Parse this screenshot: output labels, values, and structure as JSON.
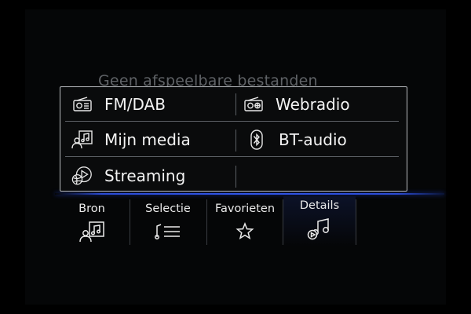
{
  "background_message": "Geen afspeelbare bestanden",
  "accent_color": "#2f55e8",
  "popup": {
    "items": [
      {
        "label": "FM/DAB",
        "icon": "radio-icon"
      },
      {
        "label": "Webradio",
        "icon": "webradio-icon"
      },
      {
        "label": "Mijn media",
        "icon": "media-user-icon"
      },
      {
        "label": "BT-audio",
        "icon": "bluetooth-icon"
      },
      {
        "label": "Streaming",
        "icon": "streaming-icon"
      }
    ]
  },
  "tabs": [
    {
      "label": "Bron",
      "icon": "media-source-icon"
    },
    {
      "label": "Selectie",
      "icon": "playlist-icon"
    },
    {
      "label": "Favorieten",
      "icon": "star-icon"
    },
    {
      "label": "Details",
      "icon": "music-note-icon"
    }
  ]
}
